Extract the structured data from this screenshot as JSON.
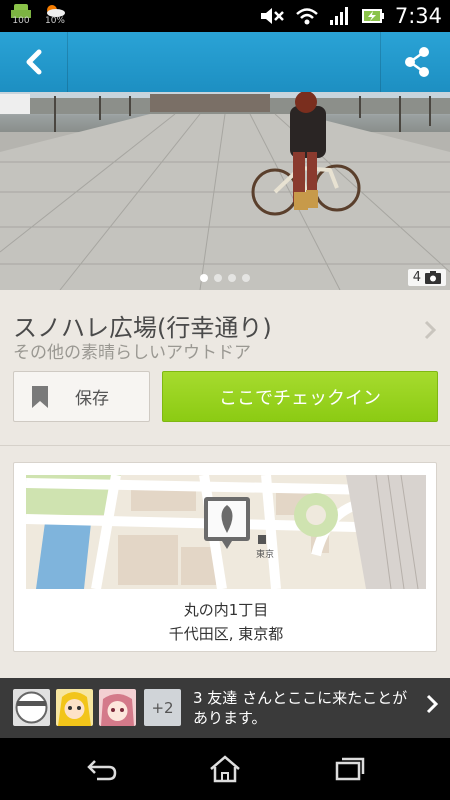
{
  "status_bar": {
    "left_icons": [
      "battery-100-icon",
      "weather-icon"
    ],
    "battery_label": "100",
    "weather_label": "10%",
    "right_icons": [
      "mute-icon",
      "wifi-icon",
      "signal-icon",
      "battery-charging-icon"
    ],
    "time": "7:34"
  },
  "action_bar": {
    "back_icon": "chevron-left-icon",
    "share_icon": "share-icon",
    "color": "#23a0d5"
  },
  "hero": {
    "photo_count": "4",
    "page_dots": 4,
    "active_dot": 0
  },
  "venue": {
    "title": "スノハレ広場(行幸通り)",
    "category": "その他の素晴らしいアウトドア"
  },
  "buttons": {
    "save_label": "保存",
    "checkin_label": "ここでチェックイン",
    "checkin_color": "#96d11e"
  },
  "map": {
    "station_label": "東京",
    "address_line1": "丸の内1丁目",
    "address_line2": "千代田区, 東京都"
  },
  "friends": {
    "extra_count": "+2",
    "message": "3 友達 さんとここに来たことがあります。"
  },
  "nav": {
    "icons": [
      "back-icon",
      "home-icon",
      "recent-apps-icon"
    ]
  }
}
